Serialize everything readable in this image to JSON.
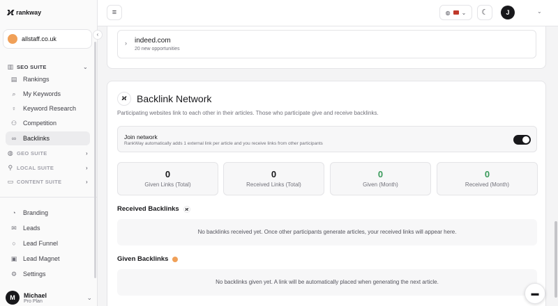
{
  "brand": {
    "logo_mark": "ϰ",
    "name": "rankway"
  },
  "site": {
    "name": "allstaff.co.uk",
    "dot_color": "#f0a058"
  },
  "sidebar": {
    "seo_suite": {
      "label": "SEO SUITE",
      "items": [
        {
          "label": "Rankings",
          "icon": "bar-chart-icon"
        },
        {
          "label": "My Keywords",
          "icon": "search-icon"
        },
        {
          "label": "Keyword Research",
          "icon": "lightbulb-icon"
        },
        {
          "label": "Competition",
          "icon": "users-icon"
        },
        {
          "label": "Backlinks",
          "icon": "link-icon"
        }
      ]
    },
    "geo_suite": {
      "label": "GEO SUITE"
    },
    "local_suite": {
      "label": "LOCAL SUITE"
    },
    "content_suite": {
      "label": "CONTENT SUITE"
    },
    "bottom_items": [
      {
        "label": "Branding",
        "icon": "palette-icon"
      },
      {
        "label": "Leads",
        "icon": "mail-icon"
      },
      {
        "label": "Lead Funnel",
        "icon": "chat-icon"
      },
      {
        "label": "Lead Magnet",
        "icon": "gift-icon"
      },
      {
        "label": "Settings",
        "icon": "gear-icon"
      }
    ],
    "user": {
      "initial": "M",
      "name": "Michael",
      "plan": "Pro Plan"
    }
  },
  "topbar": {
    "avatar_initial": "J"
  },
  "opportunity": {
    "domain": "indeed.com",
    "subtitle": "20 new opportunities"
  },
  "backlink_network": {
    "title": "Backlink Network",
    "description": "Participating websites link to each other in their articles. Those who participate give and receive backlinks.",
    "join": {
      "title": "Join network",
      "subtitle": "RankWay automatically adds 1 external link per article and you receive links from other participants",
      "enabled": true
    },
    "stats": [
      {
        "value": "0",
        "label": "Given Links (Total)"
      },
      {
        "value": "0",
        "label": "Received Links (Total)"
      },
      {
        "value": "0",
        "label": "Given (Month)"
      },
      {
        "value": "0",
        "label": "Received (Month)"
      }
    ],
    "received": {
      "title": "Received Backlinks",
      "empty": "No backlinks received yet. Once other participants generate articles, your received links will appear here."
    },
    "given": {
      "title": "Given Backlinks",
      "empty": "No backlinks given yet. A link will be automatically placed when generating the next article."
    }
  },
  "accent_green": "#3a9a5b"
}
